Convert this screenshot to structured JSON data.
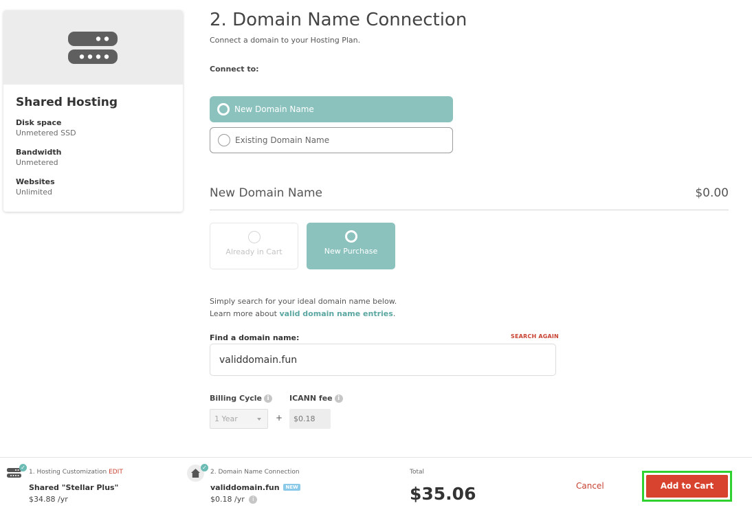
{
  "plan_card": {
    "icon": "server-icon",
    "title": "Shared Hosting",
    "specs": [
      {
        "label": "Disk space",
        "value": "Unmetered SSD"
      },
      {
        "label": "Bandwidth",
        "value": "Unmetered"
      },
      {
        "label": "Websites",
        "value": "Unlimited"
      }
    ]
  },
  "main": {
    "heading": "2. Domain Name Connection",
    "subheading": "Connect a domain to your Hosting Plan.",
    "connect_label": "Connect to:",
    "connect_options": [
      {
        "label": "New Domain Name",
        "selected": true
      },
      {
        "label": "Existing Domain Name",
        "selected": false
      }
    ],
    "section_title": "New Domain Name",
    "section_price": "$0.00",
    "purchase_tiles": [
      {
        "label": "Already in Cart",
        "selected": false,
        "disabled": true
      },
      {
        "label": "New Purchase",
        "selected": true,
        "disabled": false
      }
    ],
    "help_line1": "Simply search for your ideal domain name below.",
    "help_line2_prefix": "Learn more about ",
    "help_link": "valid domain name entries",
    "help_line2_suffix": ".",
    "find_label": "Find a domain name:",
    "search_again": "SEARCH AGAIN",
    "domain_value": "validdomain.fun",
    "billing_cycle_label": "Billing Cycle",
    "billing_cycle_value": "1 Year",
    "plus": "+",
    "icann_label": "ICANN fee",
    "icann_value": "$0.18",
    "info_glyph": "i"
  },
  "footer": {
    "step1": {
      "icon": "server-icon",
      "title": "1. Hosting Customization",
      "edit": "EDIT",
      "name": "Shared \"Stellar Plus\"",
      "price": "$34.88 /yr"
    },
    "step2": {
      "icon": "home-icon",
      "title": "2. Domain Name Connection",
      "name": "validdomain.fun",
      "badge": "NEW",
      "price": "$0.18 /yr"
    },
    "check_glyph": "✓",
    "total_label": "Total",
    "total_value": "$35.06",
    "cancel_label": "Cancel",
    "add_to_cart_label": "Add to Cart",
    "colors": {
      "accent_teal": "#8bc2be",
      "action_red": "#d8432f",
      "highlight_green": "#2fd12f"
    }
  }
}
